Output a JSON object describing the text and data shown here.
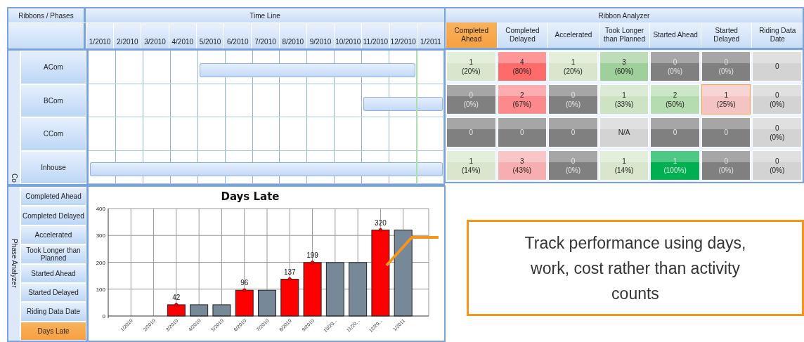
{
  "ribbons_header": "Ribbons / Phases",
  "group_label": "Co",
  "timeline": {
    "title": "Time Line",
    "columns": [
      "1/2010",
      "2/2010",
      "3/2010",
      "4/2010",
      "5/2010",
      "6/2010",
      "7/2010",
      "8/2010",
      "9/2010",
      "10/2010",
      "11/2010",
      "12/2010",
      "1/2011"
    ]
  },
  "ribbons": [
    {
      "name": "ACom",
      "months": [
        false,
        false,
        false,
        false,
        true,
        true,
        true,
        true,
        true,
        true,
        true,
        true,
        false
      ]
    },
    {
      "name": "BCom",
      "months": [
        false,
        false,
        false,
        false,
        false,
        false,
        false,
        false,
        false,
        false,
        true,
        true,
        true
      ]
    },
    {
      "name": "CCom",
      "months": [
        false,
        false,
        false,
        false,
        false,
        false,
        false,
        false,
        false,
        false,
        false,
        false,
        false
      ]
    },
    {
      "name": "Inhouse",
      "months": [
        true,
        true,
        true,
        true,
        true,
        true,
        true,
        true,
        true,
        true,
        true,
        true,
        true
      ]
    }
  ],
  "ribbon_analyzer": {
    "title": "Ribbon Analyzer",
    "columns": [
      {
        "label": "Completed Ahead",
        "selected": true
      },
      {
        "label": "Completed Delayed",
        "selected": false
      },
      {
        "label": "Accelerated",
        "selected": false
      },
      {
        "label": "Took Longer than Planned",
        "selected": false
      },
      {
        "label": "Started Ahead",
        "selected": false
      },
      {
        "label": "Started Delayed",
        "selected": false
      },
      {
        "label": "Riding Data Date",
        "selected": false
      }
    ],
    "rows": [
      [
        {
          "count": "1",
          "percent": "(20%)",
          "color": "#d7e6cc",
          "selected": false
        },
        {
          "count": "4",
          "percent": "(80%)",
          "color": "#ff6b6b",
          "selected": false
        },
        {
          "count": "1",
          "percent": "(20%)",
          "color": "#d7e6cc",
          "selected": false
        },
        {
          "count": "3",
          "percent": "(60%)",
          "color": "#9fcf9a",
          "selected": false
        },
        {
          "count": "0",
          "percent": "(0%)",
          "color": "#808080",
          "selected": false
        },
        {
          "count": "0",
          "percent": "(0%)",
          "color": "#808080",
          "selected": false
        },
        {
          "count": "0",
          "color": "#d3d3d3",
          "selected": false
        }
      ],
      [
        {
          "count": "0",
          "percent": "(0%)",
          "color": "#808080",
          "selected": false
        },
        {
          "count": "2",
          "percent": "(67%)",
          "color": "#fc8a8c",
          "selected": false
        },
        {
          "count": "0",
          "percent": "(0%)",
          "color": "#808080",
          "selected": false
        },
        {
          "count": "1",
          "percent": "(33%)",
          "color": "#cde3c4",
          "selected": false
        },
        {
          "count": "2",
          "percent": "(50%)",
          "color": "#b5dcb0",
          "selected": false
        },
        {
          "count": "1",
          "percent": "(25%)",
          "color": "#f4c3c3",
          "selected": true
        },
        {
          "count": "0",
          "percent": "(0%)",
          "color": "#d3d3d3",
          "selected": false
        }
      ],
      [
        {
          "count": "0",
          "color": "#808080",
          "selected": false
        },
        {
          "count": "0",
          "color": "#808080",
          "selected": false
        },
        {
          "count": "0",
          "color": "#808080",
          "selected": false
        },
        {
          "count": "N/A",
          "color": "#d3d3d3",
          "selected": false
        },
        {
          "count": "0",
          "color": "#808080",
          "selected": false
        },
        {
          "count": "0",
          "color": "#808080",
          "selected": false
        },
        {
          "count": "0",
          "percent": "(0%)",
          "color": "#d3d3d3",
          "selected": false
        }
      ],
      [
        {
          "count": "1",
          "percent": "(14%)",
          "color": "#d7e6cc",
          "selected": false
        },
        {
          "count": "3",
          "percent": "(43%)",
          "color": "#f6aeb0",
          "selected": false
        },
        {
          "count": "0",
          "percent": "(0%)",
          "color": "#808080",
          "selected": false
        },
        {
          "count": "1",
          "percent": "(14%)",
          "color": "#d7e6cc",
          "selected": false
        },
        {
          "count": "1",
          "percent": "(100%)",
          "color": "#00b050",
          "selected": false
        },
        {
          "count": "0",
          "percent": "(0%)",
          "color": "#808080",
          "selected": false
        },
        {
          "count": "0",
          "percent": "(0%)",
          "color": "#d3d3d3",
          "selected": false
        }
      ]
    ]
  },
  "phase_analyzer": {
    "title": "Phase Analyzer",
    "items": [
      {
        "label": "Completed Ahead",
        "selected": false
      },
      {
        "label": "Completed Delayed",
        "selected": false
      },
      {
        "label": "Accelerated",
        "selected": false
      },
      {
        "label": "Took Longer than Planned",
        "selected": false
      },
      {
        "label": "Started Ahead",
        "selected": false
      },
      {
        "label": "Started Delayed",
        "selected": false
      },
      {
        "label": "Riding Data Date",
        "selected": false
      },
      {
        "label": "Days Late",
        "selected": true
      }
    ],
    "chart_data": {
      "type": "bar",
      "title": "Days Late",
      "stacked": true,
      "grid": true,
      "categories": [
        "1/2010",
        "2/2010",
        "3/2010",
        "4/2010",
        "5/2010",
        "6/2010",
        "7/2010",
        "8/2010",
        "9/2010",
        "10/20...",
        "11/20...",
        "12/20...",
        "1/2011"
      ],
      "ylim": [
        0,
        400
      ],
      "yticks": [
        0,
        100,
        200,
        300,
        400
      ],
      "series": [
        {
          "color": "#ff0000",
          "values": [
            null,
            null,
            42,
            null,
            null,
            96,
            null,
            137,
            199,
            null,
            null,
            320,
            null
          ]
        },
        {
          "color": "#778899",
          "values": [
            null,
            null,
            null,
            42,
            42,
            null,
            96,
            null,
            null,
            199,
            199,
            null,
            320
          ]
        }
      ],
      "value_labels": [
        null,
        null,
        "42",
        null,
        null,
        "96",
        null,
        "137",
        "199",
        null,
        null,
        "320",
        null
      ]
    }
  },
  "callout": {
    "text": "Track performance using days, work, cost rather than activity counts"
  }
}
